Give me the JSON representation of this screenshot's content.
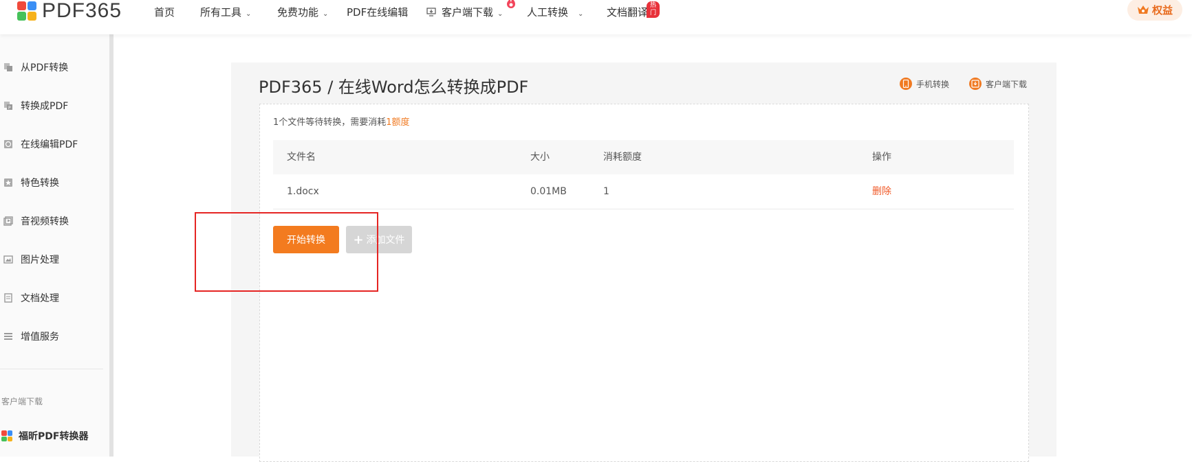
{
  "header": {
    "logo_text": "PDF365",
    "nav": [
      {
        "label": "首页",
        "has_chevron": false
      },
      {
        "label": "所有工具",
        "has_chevron": true
      },
      {
        "label": "免费功能",
        "has_chevron": true
      },
      {
        "label": "PDF在线编辑",
        "has_chevron": false
      },
      {
        "label": "客户端下载",
        "has_chevron": true,
        "icon": "monitor-download-icon"
      },
      {
        "label": "人工转换",
        "has_chevron": true,
        "icon": "fire-icon"
      },
      {
        "label": "文档翻译",
        "has_chevron": false
      }
    ],
    "hot_badge": "热门",
    "rights_label": "权益"
  },
  "sidebar": {
    "items": [
      {
        "label": "从PDF转换",
        "icon": "from-pdf-icon"
      },
      {
        "label": "转换成PDF",
        "icon": "to-pdf-icon"
      },
      {
        "label": "在线编辑PDF",
        "icon": "edit-pdf-icon"
      },
      {
        "label": "特色转换",
        "icon": "special-convert-icon"
      },
      {
        "label": "音视频转换",
        "icon": "media-convert-icon"
      },
      {
        "label": "图片处理",
        "icon": "image-process-icon"
      },
      {
        "label": "文档处理",
        "icon": "document-process-icon"
      },
      {
        "label": "增值服务",
        "icon": "value-service-icon"
      }
    ],
    "client_caption": "客户端下载",
    "client_app": "福昕PDF转换器"
  },
  "main": {
    "breadcrumb": "PDF365 / 在线Word怎么转换成PDF",
    "mobile_link": "手机转换",
    "client_link": "客户端下载",
    "info_prefix": "1个文件等待转换，需要消耗",
    "info_highlight": "1额度",
    "table": {
      "headers": [
        "文件名",
        "大小",
        "消耗额度",
        "操作"
      ],
      "rows": [
        {
          "name": "1.docx",
          "size": "0.01MB",
          "credits": "1",
          "action": "删除"
        }
      ]
    },
    "start_button": "开始转换",
    "add_button": "添加文件"
  },
  "colors": {
    "accent": "#f37b1f",
    "delete": "#f05a28",
    "annotation_box": "#e52422"
  }
}
